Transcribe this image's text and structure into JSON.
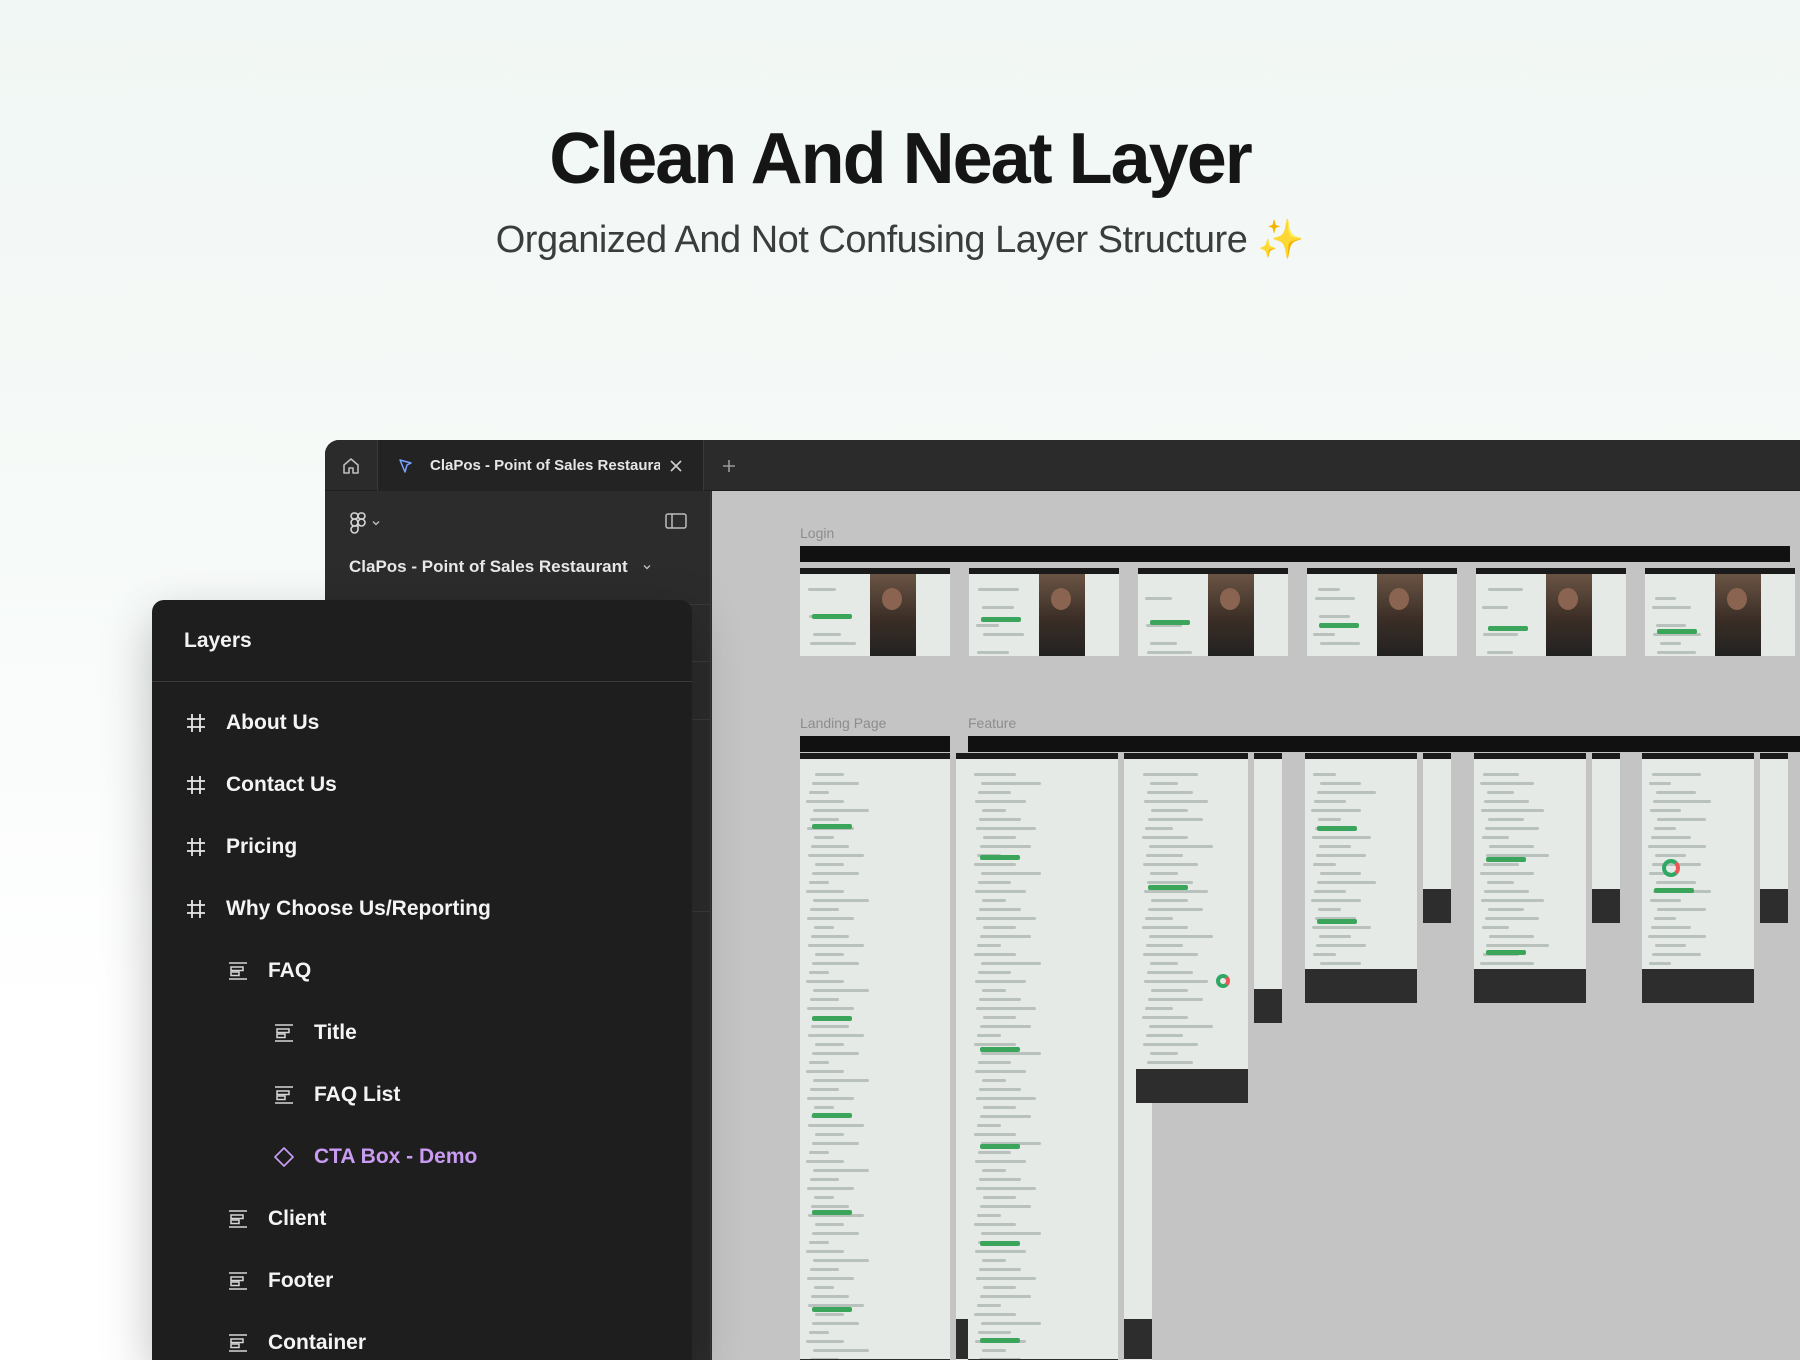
{
  "hero": {
    "title": "Clean And Neat Layer",
    "subtitle": "Organized And Not Confusing Layer Structure",
    "subtitle_emoji": "✨"
  },
  "app": {
    "tab_label": "ClaPos - Point of Sales Restaurant",
    "file_title": "ClaPos - Point of Sales Restaurant",
    "icons": [
      "home-icon",
      "file-icon",
      "close-icon",
      "plus-icon",
      "figma-logo-icon",
      "chevron-down-icon",
      "panel-toggle-icon"
    ]
  },
  "canvas": {
    "sections": [
      {
        "label": "Login"
      },
      {
        "label": "Landing Page"
      },
      {
        "label": "Feature"
      }
    ]
  },
  "layers": {
    "title": "Layers",
    "items": [
      {
        "label": "About Us",
        "icon": "frame-icon",
        "level": 0
      },
      {
        "label": "Contact Us",
        "icon": "frame-icon",
        "level": 0
      },
      {
        "label": "Pricing",
        "icon": "frame-icon",
        "level": 0
      },
      {
        "label": "Why Choose Us/Reporting",
        "icon": "frame-icon",
        "level": 0
      },
      {
        "label": "FAQ",
        "icon": "auto-layout-icon",
        "level": 1
      },
      {
        "label": "Title",
        "icon": "auto-layout-icon",
        "level": 2
      },
      {
        "label": "FAQ List",
        "icon": "auto-layout-icon",
        "level": 2
      },
      {
        "label": "CTA Box - Demo",
        "icon": "component-instance-icon",
        "level": 2
      },
      {
        "label": "Client",
        "icon": "auto-layout-icon",
        "level": 1
      },
      {
        "label": "Footer",
        "icon": "auto-layout-icon",
        "level": 1
      },
      {
        "label": "Container",
        "icon": "auto-layout-icon",
        "level": 1
      }
    ]
  },
  "colors": {
    "accent_component": "#c99bf2",
    "canvas_bg": "#c4c4c4",
    "panel_bg": "#1e1e1e"
  }
}
